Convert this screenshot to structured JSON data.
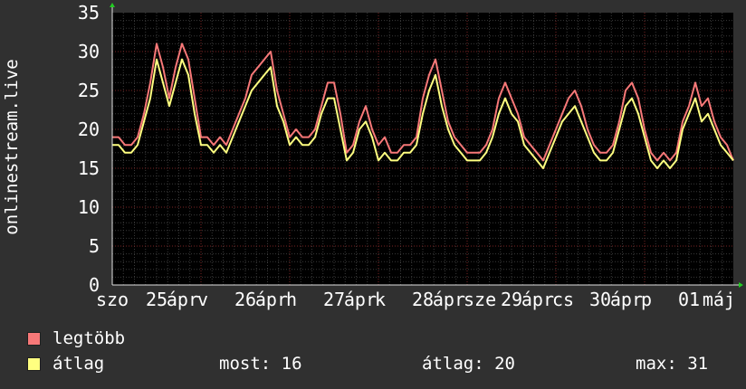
{
  "chart_data": {
    "type": "line",
    "ylabel": "onlinestream.live",
    "ylim": [
      0,
      35
    ],
    "y_ticks": [
      "0",
      "5",
      "10",
      "15",
      "20",
      "25",
      "30",
      "35"
    ],
    "x_tick_labels": [
      {
        "text": "szo",
        "x": 0
      },
      {
        "text": "25",
        "x": 0.5
      },
      {
        "text": "ápr",
        "x": 1
      },
      {
        "text": "v",
        "x": 1.0
      },
      {
        "text": "26",
        "x": 1.5
      },
      {
        "text": "ápr",
        "x": 2
      },
      {
        "text": "h",
        "x": 2.0
      },
      {
        "text": "27",
        "x": 2.5
      },
      {
        "text": "ápr",
        "x": 3
      },
      {
        "text": "k",
        "x": 3.0
      },
      {
        "text": "28",
        "x": 3.5
      },
      {
        "text": "ápr",
        "x": 4
      },
      {
        "text": "sze",
        "x": 4.0
      },
      {
        "text": "29",
        "x": 4.5
      },
      {
        "text": "ápr",
        "x": 5
      },
      {
        "text": "cs",
        "x": 5.0
      },
      {
        "text": "30",
        "x": 5.5
      },
      {
        "text": "ápr",
        "x": 6
      },
      {
        "text": "p",
        "x": 6.0
      },
      {
        "text": "01",
        "x": 6.5
      },
      {
        "text": "máj",
        "x": 7
      }
    ],
    "xlim": [
      0,
      7
    ],
    "grid": true,
    "series": [
      {
        "name": "legtöbb",
        "color": "#f87878",
        "x": [
          0,
          0.071,
          0.143,
          0.214,
          0.286,
          0.357,
          0.429,
          0.5,
          0.571,
          0.643,
          0.714,
          0.786,
          0.857,
          0.929,
          1.0,
          1.071,
          1.143,
          1.214,
          1.286,
          1.357,
          1.429,
          1.5,
          1.571,
          1.643,
          1.714,
          1.786,
          1.857,
          1.929,
          2.0,
          2.071,
          2.143,
          2.214,
          2.286,
          2.357,
          2.429,
          2.5,
          2.571,
          2.643,
          2.714,
          2.786,
          2.857,
          2.929,
          3.0,
          3.071,
          3.143,
          3.214,
          3.286,
          3.357,
          3.429,
          3.5,
          3.571,
          3.643,
          3.714,
          3.786,
          3.857,
          3.929,
          4.0,
          4.071,
          4.143,
          4.214,
          4.286,
          4.357,
          4.429,
          4.5,
          4.571,
          4.643,
          4.714,
          4.786,
          4.857,
          4.929,
          5.0,
          5.071,
          5.143,
          5.214,
          5.286,
          5.357,
          5.429,
          5.5,
          5.571,
          5.643,
          5.714,
          5.786,
          5.857,
          5.929,
          6.0,
          6.071,
          6.143,
          6.214,
          6.286,
          6.357,
          6.429,
          6.5,
          6.571,
          6.643,
          6.714,
          6.786,
          6.857,
          6.929,
          7.0
        ],
        "values": [
          19,
          19,
          18,
          18,
          19,
          22,
          26,
          31,
          28,
          24,
          28,
          31,
          29,
          24,
          19,
          19,
          18,
          19,
          18,
          20,
          22,
          24,
          27,
          28,
          29,
          30,
          25,
          22,
          19,
          20,
          19,
          19,
          20,
          23,
          26,
          26,
          22,
          17,
          18,
          21,
          23,
          20,
          18,
          19,
          17,
          17,
          18,
          18,
          19,
          24,
          27,
          29,
          25,
          21,
          19,
          18,
          17,
          17,
          17,
          18,
          20,
          24,
          26,
          24,
          22,
          19,
          18,
          17,
          16,
          18,
          20,
          22,
          24,
          25,
          23,
          20,
          18,
          17,
          17,
          18,
          21,
          25,
          26,
          24,
          20,
          17,
          16,
          17,
          16,
          17,
          21,
          23,
          26,
          23,
          24,
          21,
          19,
          18,
          16
        ]
      },
      {
        "name": "átlag",
        "color": "#ffff80",
        "x": [
          0,
          0.071,
          0.143,
          0.214,
          0.286,
          0.357,
          0.429,
          0.5,
          0.571,
          0.643,
          0.714,
          0.786,
          0.857,
          0.929,
          1.0,
          1.071,
          1.143,
          1.214,
          1.286,
          1.357,
          1.429,
          1.5,
          1.571,
          1.643,
          1.714,
          1.786,
          1.857,
          1.929,
          2.0,
          2.071,
          2.143,
          2.214,
          2.286,
          2.357,
          2.429,
          2.5,
          2.571,
          2.643,
          2.714,
          2.786,
          2.857,
          2.929,
          3.0,
          3.071,
          3.143,
          3.214,
          3.286,
          3.357,
          3.429,
          3.5,
          3.571,
          3.643,
          3.714,
          3.786,
          3.857,
          3.929,
          4.0,
          4.071,
          4.143,
          4.214,
          4.286,
          4.357,
          4.429,
          4.5,
          4.571,
          4.643,
          4.714,
          4.786,
          4.857,
          4.929,
          5.0,
          5.071,
          5.143,
          5.214,
          5.286,
          5.357,
          5.429,
          5.5,
          5.571,
          5.643,
          5.714,
          5.786,
          5.857,
          5.929,
          6.0,
          6.071,
          6.143,
          6.214,
          6.286,
          6.357,
          6.429,
          6.5,
          6.571,
          6.643,
          6.714,
          6.786,
          6.857,
          6.929,
          7.0
        ],
        "values": [
          18,
          18,
          17,
          17,
          18,
          21,
          24,
          29,
          26,
          23,
          26,
          29,
          27,
          22,
          18,
          18,
          17,
          18,
          17,
          19,
          21,
          23,
          25,
          26,
          27,
          28,
          23,
          21,
          18,
          19,
          18,
          18,
          19,
          22,
          24,
          24,
          20,
          16,
          17,
          20,
          21,
          19,
          16,
          17,
          16,
          16,
          17,
          17,
          18,
          22,
          25,
          27,
          23,
          20,
          18,
          17,
          16,
          16,
          16,
          17,
          19,
          22,
          24,
          22,
          21,
          18,
          17,
          16,
          15,
          17,
          19,
          21,
          22,
          23,
          21,
          19,
          17,
          16,
          16,
          17,
          20,
          23,
          24,
          22,
          19,
          16,
          15,
          16,
          15,
          16,
          20,
          22,
          24,
          21,
          22,
          20,
          18,
          17,
          16
        ]
      }
    ],
    "legend": [
      {
        "label": "legtöbb",
        "color": "#f87878"
      },
      {
        "label": "átlag",
        "color": "#ffff80"
      }
    ],
    "legend_position": "bottom-left"
  },
  "stats": {
    "most_label": "most:",
    "most_value": "16",
    "atlag_label": "átlag:",
    "atlag_value": "20",
    "max_label": "max:",
    "max_value": "31"
  }
}
